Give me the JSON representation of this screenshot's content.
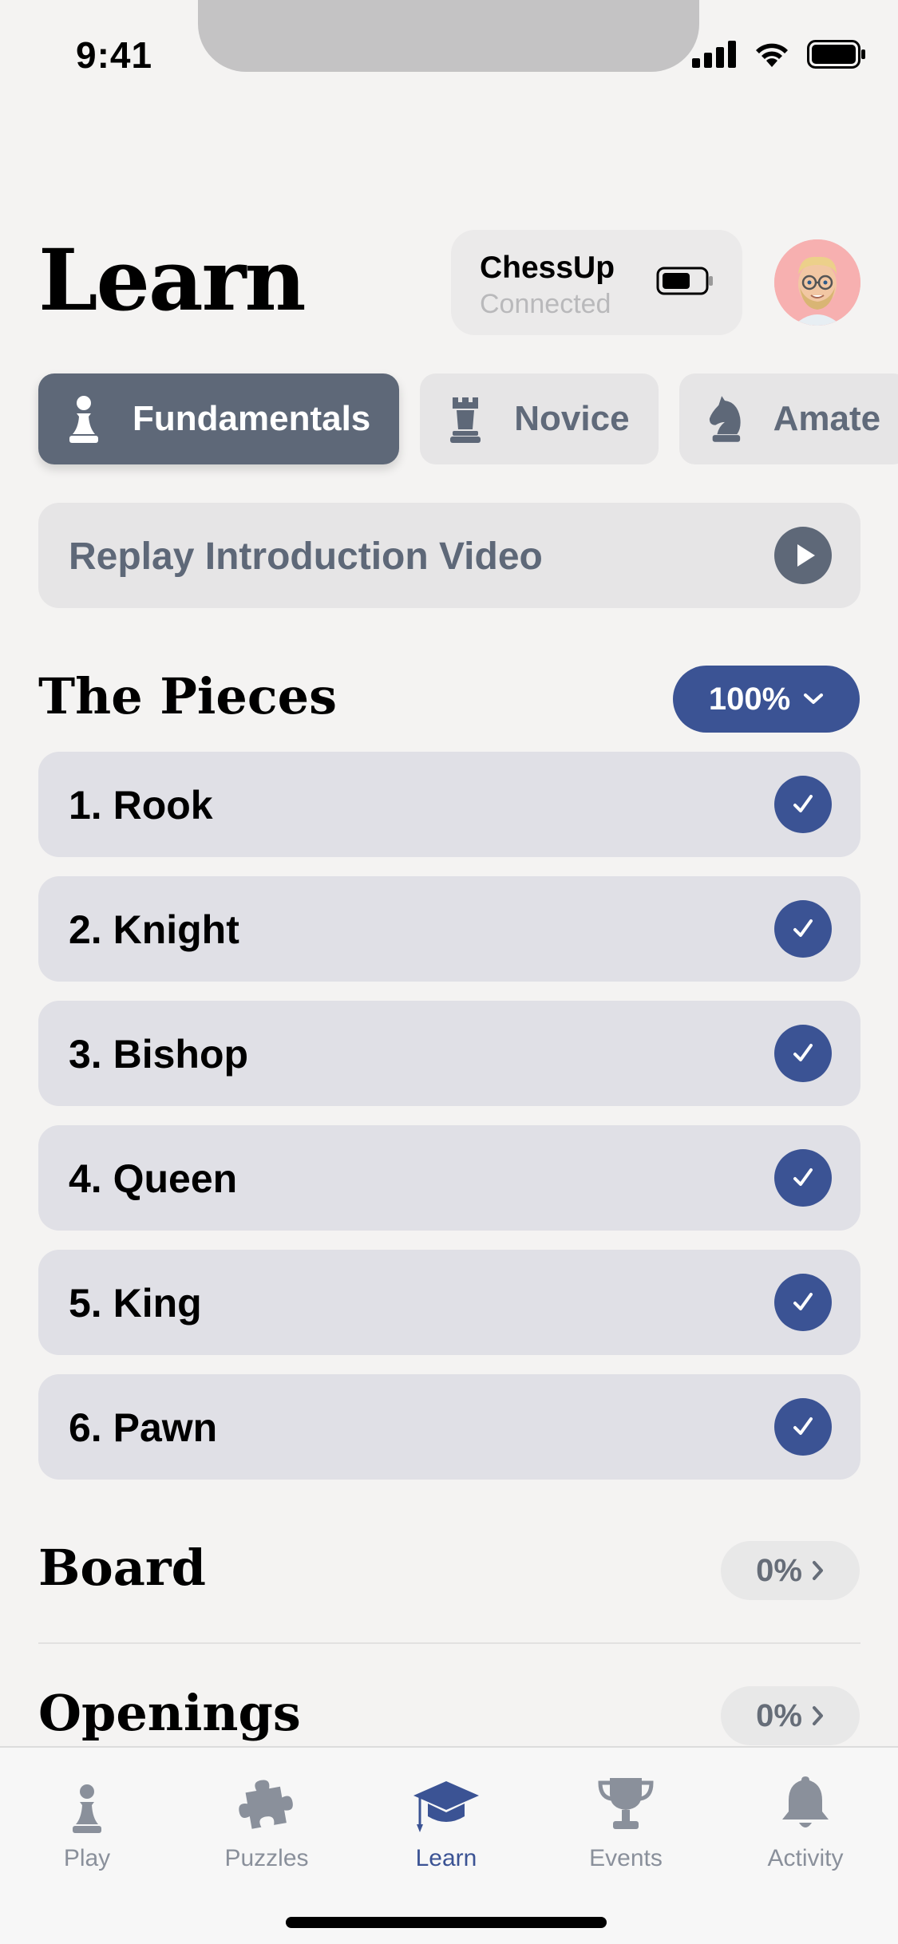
{
  "status_bar": {
    "time": "9:41"
  },
  "header": {
    "title": "Learn",
    "device": {
      "name": "ChessUp",
      "status": "Connected"
    }
  },
  "tabs": [
    {
      "label": "Fundamentals",
      "icon": "pawn-icon",
      "active": true
    },
    {
      "label": "Novice",
      "icon": "rook-icon",
      "active": false
    },
    {
      "label": "Amate",
      "icon": "knight-icon",
      "active": false
    }
  ],
  "intro": {
    "label": "Replay Introduction Video"
  },
  "pieces_section": {
    "title": "The Pieces",
    "progress": "100%",
    "lessons": [
      {
        "label": "1. Rook",
        "complete": true
      },
      {
        "label": "2. Knight",
        "complete": true
      },
      {
        "label": "3. Bishop",
        "complete": true
      },
      {
        "label": "4. Queen",
        "complete": true
      },
      {
        "label": "5. King",
        "complete": true
      },
      {
        "label": "6. Pawn",
        "complete": true
      }
    ]
  },
  "board_section": {
    "title": "Board",
    "progress": "0%"
  },
  "openings_section": {
    "title": "Openings",
    "progress": "0%"
  },
  "tab_bar": [
    {
      "label": "Play",
      "icon": "pawn-icon",
      "active": false
    },
    {
      "label": "Puzzles",
      "icon": "puzzle-icon",
      "active": false
    },
    {
      "label": "Learn",
      "icon": "graduation-cap-icon",
      "active": true
    },
    {
      "label": "Events",
      "icon": "trophy-icon",
      "active": false
    },
    {
      "label": "Activity",
      "icon": "bell-icon",
      "active": false
    }
  ],
  "colors": {
    "accent": "#3b5394",
    "tab_active": "#5e6878",
    "background": "#f4f3f2"
  }
}
